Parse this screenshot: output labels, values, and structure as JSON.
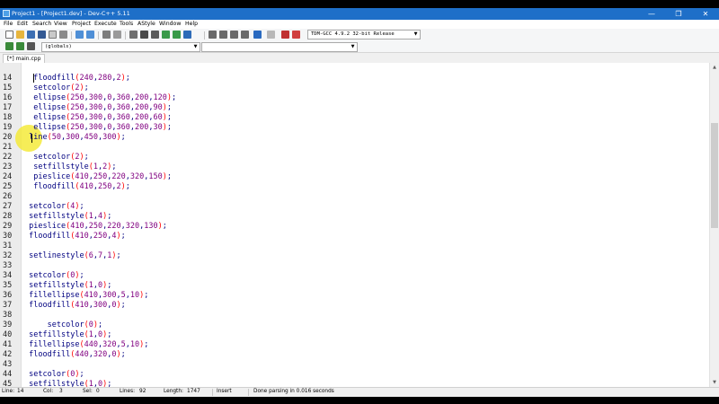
{
  "window": {
    "title": "Project1 - [Project1.dev] - Dev-C++ 5.11",
    "minimize_glyph": "—",
    "maximize_glyph": "❐",
    "close_glyph": "✕"
  },
  "menu": [
    "File",
    "Edit",
    "Search",
    "View",
    "Project",
    "Execute",
    "Tools",
    "AStyle",
    "Window",
    "Help"
  ],
  "toolbar": {
    "compiler_select": "TDM-GCC 4.9.2 32-bit Release",
    "scope_select": "(globals)",
    "function_select": ""
  },
  "tab": {
    "file_label": "[*] main.cpp"
  },
  "editor": {
    "lines": [
      {
        "no": "14",
        "text": "  floodfill(240,280,2);"
      },
      {
        "no": "15",
        "text": "  setcolor(2);"
      },
      {
        "no": "16",
        "text": "  ellipse(250,300,0,360,200,120);"
      },
      {
        "no": "17",
        "text": "  ellipse(250,300,0,360,200,90);"
      },
      {
        "no": "18",
        "text": "  ellipse(250,300,0,360,200,60);"
      },
      {
        "no": "19",
        "text": "  ellipse(250,300,0,360,200,30);"
      },
      {
        "no": "20",
        "text": " line(50,300,450,300);"
      },
      {
        "no": "21",
        "text": ""
      },
      {
        "no": "22",
        "text": "  setcolor(2);"
      },
      {
        "no": "23",
        "text": "  setfillstyle(1,2);"
      },
      {
        "no": "24",
        "text": "  pieslice(410,250,220,320,150);"
      },
      {
        "no": "25",
        "text": "  floodfill(410,250,2);"
      },
      {
        "no": "26",
        "text": ""
      },
      {
        "no": "27",
        "text": " setcolor(4);"
      },
      {
        "no": "28",
        "text": " setfillstyle(1,4);"
      },
      {
        "no": "29",
        "text": " pieslice(410,250,220,320,130);"
      },
      {
        "no": "30",
        "text": " floodfill(410,250,4);"
      },
      {
        "no": "31",
        "text": ""
      },
      {
        "no": "32",
        "text": " setlinestyle(6,7,1);"
      },
      {
        "no": "33",
        "text": ""
      },
      {
        "no": "34",
        "text": " setcolor(0);"
      },
      {
        "no": "35",
        "text": " setfillstyle(1,0);"
      },
      {
        "no": "36",
        "text": " fillellipse(410,300,5,10);"
      },
      {
        "no": "37",
        "text": " floodfill(410,300,0);"
      },
      {
        "no": "38",
        "text": ""
      },
      {
        "no": "39",
        "text": "     setcolor(0);"
      },
      {
        "no": "40",
        "text": " setfillstyle(1,0);"
      },
      {
        "no": "41",
        "text": " fillellipse(440,320,5,10);"
      },
      {
        "no": "42",
        "text": " floodfill(440,320,0);"
      },
      {
        "no": "43",
        "text": ""
      },
      {
        "no": "44",
        "text": " setcolor(0);"
      },
      {
        "no": "45",
        "text": " setfillstyle(1,0);"
      }
    ]
  },
  "status": {
    "line_label": "Line:",
    "line_value": "14",
    "col_label": "Col:",
    "col_value": "3",
    "sel_label": "Sel:",
    "sel_value": "0",
    "lines_label": "Lines:",
    "lines_value": "92",
    "length_label": "Length:",
    "length_value": "1747",
    "mode": "Insert",
    "message": "Done parsing in 0.016 seconds"
  },
  "colors": {
    "titlebar": "#1e6fc8",
    "code_text": "#000080",
    "number": "#800080",
    "paren": "#ff0000",
    "cursor_highlight": "#f4ea3b"
  },
  "icons": [
    "app-icon",
    "new-file-icon",
    "open-icon",
    "save-icon",
    "save-all-icon",
    "close-file-icon",
    "print-icon",
    "undo-icon",
    "redo-icon",
    "find-icon",
    "replace-icon",
    "compile-icon",
    "run-icon",
    "compile-run-icon",
    "rebuild-icon",
    "debug-icon",
    "check-icon",
    "stop-icon",
    "chart-icon",
    "bookmark-icon",
    "indent-icon",
    "unindent-icon",
    "toggle-comment-icon",
    "goto-icon"
  ]
}
